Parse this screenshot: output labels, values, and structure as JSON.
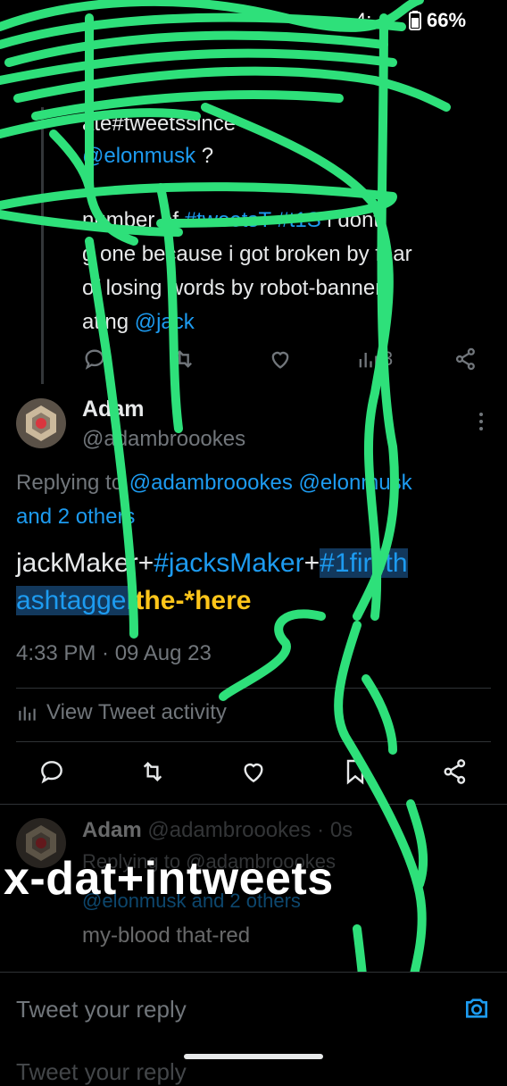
{
  "status_bar": {
    "time": "4:",
    "battery": "66%"
  },
  "prev_tweet": {
    "line1": "ate#tweetssince",
    "line2_handle": "@elonmusk",
    "line2_rest": " ?",
    "line3_pre": "number of ",
    "line3_tags": "#tweetsT #t1S",
    "line3_post": " i dont",
    "line4": "g one because i got broken by fear",
    "line5": "of losing words by robot-banner",
    "line6_pre": "ating ",
    "line6_handle": "@jack",
    "views_count": "3"
  },
  "main_tweet": {
    "name": "Adam",
    "handle": "@adambroookes",
    "replying_label": "Replying to ",
    "replying_targets": "@adambroookes @elonmusk",
    "replying_more": "and 2 others",
    "text_l1_plain": "jackMaker+",
    "text_l1_tag": "#jacksMaker",
    "text_l1_plus": "+",
    "text_l1_hl": "#1firsth",
    "text_l2_hl": "ashtagger",
    "text_l2_yellow": "the-*here",
    "timestamp": "4:33 PM · 09 Aug 23",
    "activity_label": "View Tweet activity"
  },
  "reply_tweet": {
    "name": "Adam",
    "meta": "@adambroookes · 0s",
    "replying_line": "Replying to @adambroookes",
    "replying_more": "@elonmusk and 2 others",
    "text": "my-blood that-red"
  },
  "overlay": {
    "text": "x-dat+intweets"
  },
  "composer": {
    "placeholder": "Tweet your reply",
    "placeholder_2": "Tweet your reply"
  },
  "colors": {
    "link": "#1d9bf0",
    "highlight": "#12385c",
    "yellow": "#ffc61a",
    "scribble": "#2ee07a"
  }
}
